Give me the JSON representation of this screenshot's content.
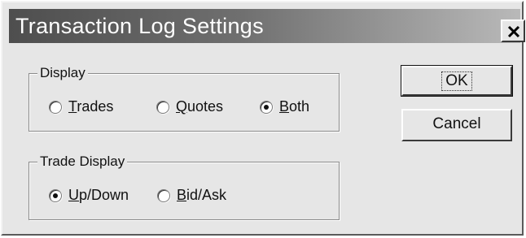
{
  "window": {
    "title": "Transaction Log Settings",
    "close_icon": "close-icon"
  },
  "display_group": {
    "label": "Display",
    "options": [
      {
        "mnemonic": "T",
        "rest": "rades",
        "selected": false
      },
      {
        "mnemonic": "Q",
        "rest": "uotes",
        "selected": false
      },
      {
        "mnemonic": "B",
        "rest": "oth",
        "selected": true
      }
    ]
  },
  "trade_display_group": {
    "label": "Trade Display",
    "options": [
      {
        "mnemonic": "U",
        "rest": "p/Down",
        "selected": true
      },
      {
        "mnemonic": "B",
        "rest": "id/Ask",
        "selected": false
      }
    ]
  },
  "buttons": {
    "ok_label": "OK",
    "cancel_label": "Cancel"
  }
}
